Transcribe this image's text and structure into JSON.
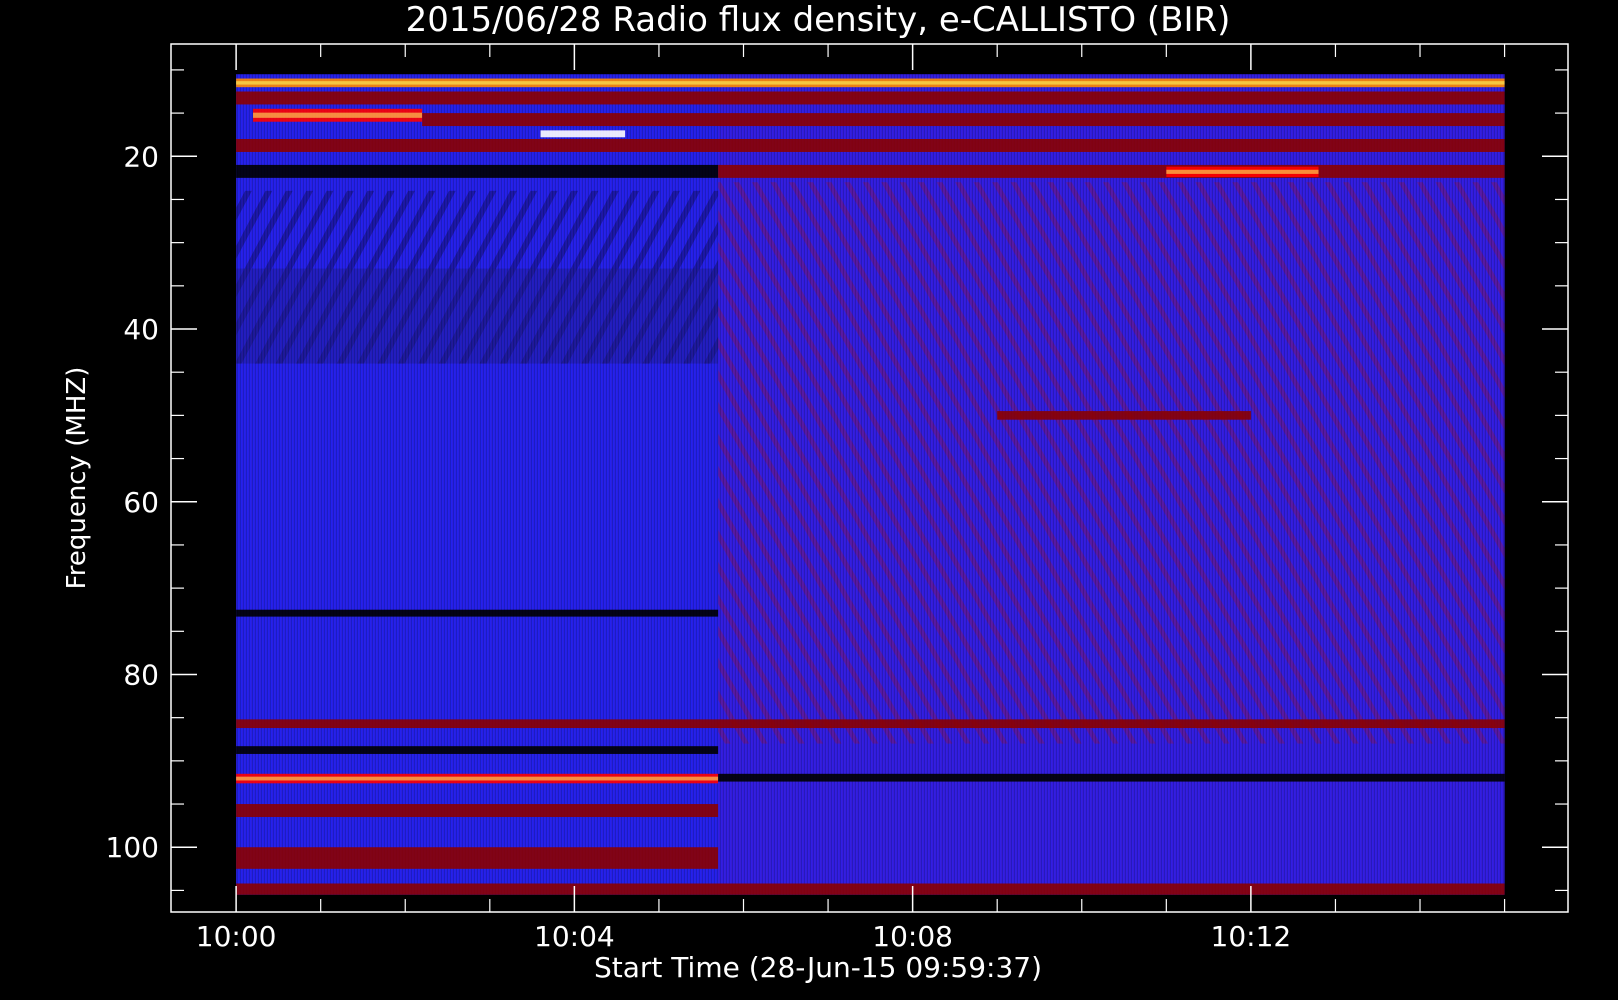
{
  "chart_data": {
    "type": "heatmap",
    "title": "2015/06/28  Radio flux density, e-CALLISTO (BIR)",
    "xlabel": "Start Time (28-Jun-15 09:59:37)",
    "ylabel": "Frequency (MHZ)",
    "x_ticks": [
      "10:00",
      "10:04",
      "10:08",
      "10:12"
    ],
    "y_ticks": [
      "20",
      "40",
      "60",
      "80",
      "100"
    ],
    "x_tick_values_min": [
      0,
      4,
      8,
      12
    ],
    "y_tick_values": [
      20,
      40,
      60,
      80,
      100
    ],
    "xlim_min": [
      -0.77,
      15.75
    ],
    "ylim": [
      107.5,
      7
    ],
    "data_extent": {
      "x_min": [
        0,
        15
      ],
      "y_mhz": [
        10.5,
        105.5
      ]
    },
    "regime_switch_min": 5.7,
    "colormap": [
      "#000000",
      "#1c1c8c",
      "#0000ff",
      "#8b0000",
      "#ff0000",
      "#ff8c00",
      "#ffff66",
      "#ffffff"
    ],
    "background_color": "#2222ee",
    "bands": [
      {
        "y_mhz": [
          11,
          12
        ],
        "x_min": [
          0,
          15
        ],
        "level": "bright"
      },
      {
        "y_mhz": [
          12.5,
          14
        ],
        "x_min": [
          0,
          15
        ],
        "level": "mixed"
      },
      {
        "y_mhz": [
          14.5,
          16
        ],
        "x_min": [
          0.2,
          2.2
        ],
        "level": "hot"
      },
      {
        "y_mhz": [
          15,
          16.5
        ],
        "x_min": [
          2.2,
          15
        ],
        "level": "mixed"
      },
      {
        "y_mhz": [
          17,
          17.8
        ],
        "x_min": [
          3.6,
          4.6
        ],
        "level": "white"
      },
      {
        "y_mhz": [
          18,
          19.5
        ],
        "x_min": [
          0,
          15
        ],
        "level": "red"
      },
      {
        "y_mhz": [
          21,
          22.5
        ],
        "x_min": [
          0,
          5.7
        ],
        "level": "dark"
      },
      {
        "y_mhz": [
          21,
          22.5
        ],
        "x_min": [
          5.7,
          15
        ],
        "level": "red"
      },
      {
        "y_mhz": [
          21.2,
          22.4
        ],
        "x_min": [
          11,
          12.8
        ],
        "level": "hot"
      },
      {
        "y_mhz": [
          49.5,
          50.5
        ],
        "x_min": [
          9,
          12
        ],
        "level": "red"
      },
      {
        "y_mhz": [
          72.5,
          73.3
        ],
        "x_min": [
          0,
          5.7
        ],
        "level": "dark"
      },
      {
        "y_mhz": [
          85.2,
          86.2
        ],
        "x_min": [
          0,
          15
        ],
        "level": "red"
      },
      {
        "y_mhz": [
          88.3,
          89.2
        ],
        "x_min": [
          0,
          5.7
        ],
        "level": "dark"
      },
      {
        "y_mhz": [
          91.5,
          92.6
        ],
        "x_min": [
          0,
          5.7
        ],
        "level": "hot"
      },
      {
        "y_mhz": [
          91.5,
          92.4
        ],
        "x_min": [
          5.7,
          15
        ],
        "level": "dark"
      },
      {
        "y_mhz": [
          95,
          96.5
        ],
        "x_min": [
          0,
          5.7
        ],
        "level": "red"
      },
      {
        "y_mhz": [
          100,
          102.5
        ],
        "x_min": [
          0,
          5.7
        ],
        "level": "red"
      },
      {
        "y_mhz": [
          104.2,
          105.5
        ],
        "x_min": [
          0,
          15
        ],
        "level": "mixed"
      }
    ]
  }
}
